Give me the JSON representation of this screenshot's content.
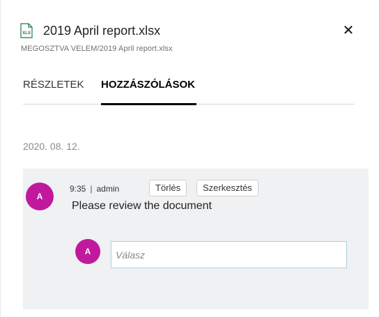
{
  "file": {
    "icon": "xlsx-file-icon",
    "icon_label": "XLS",
    "name": "2019 April report.xlsx",
    "path": "MEGOSZTVA VELEM/2019 April report.xlsx"
  },
  "close_icon": "close-icon",
  "close_glyph": "✕",
  "tabs": [
    {
      "label": "RÉSZLETEK",
      "active": false
    },
    {
      "label": "HOZZÁSZÓLÁSOK",
      "active": true
    }
  ],
  "comments": {
    "date": "2020. 08. 12.",
    "items": [
      {
        "avatar_initial": "A",
        "time": "9:35",
        "separator": "|",
        "author": "admin",
        "delete_label": "Törlés",
        "edit_label": "Szerkesztés",
        "text": "Please review the document"
      }
    ],
    "reply": {
      "avatar_initial": "A",
      "placeholder": "Válasz",
      "value": ""
    }
  },
  "colors": {
    "avatar": "#c0199e",
    "xlsx_green": "#1d7a45",
    "comment_bg": "#f0f1f2",
    "input_border": "#a9cfe8"
  }
}
